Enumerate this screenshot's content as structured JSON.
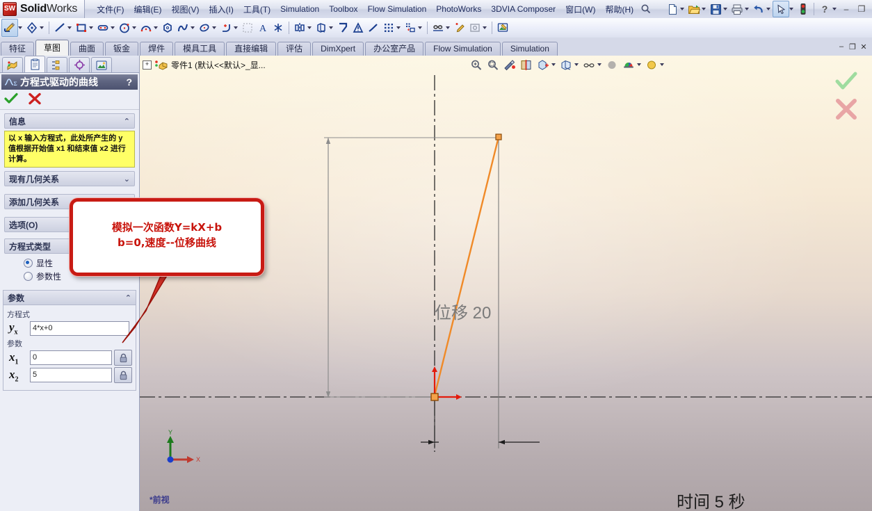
{
  "app": {
    "brand_bold": "Solid",
    "brand_light": "Works",
    "logo_mark": "SW"
  },
  "menu": {
    "items": [
      {
        "label": "文件(F)",
        "name": "menu-file"
      },
      {
        "label": "编辑(E)",
        "name": "menu-edit"
      },
      {
        "label": "视图(V)",
        "name": "menu-view"
      },
      {
        "label": "插入(I)",
        "name": "menu-insert"
      },
      {
        "label": "工具(T)",
        "name": "menu-tools"
      },
      {
        "label": "Simulation",
        "name": "menu-simulation"
      },
      {
        "label": "Toolbox",
        "name": "menu-toolbox"
      },
      {
        "label": "Flow Simulation",
        "name": "menu-flow-simulation"
      },
      {
        "label": "PhotoWorks",
        "name": "menu-photoworks"
      },
      {
        "label": "3DVIA Composer",
        "name": "menu-3dvia-composer"
      },
      {
        "label": "窗口(W)",
        "name": "menu-window"
      },
      {
        "label": "帮助(H)",
        "name": "menu-help"
      }
    ],
    "quick_access": [
      "new-document-icon",
      "open-folder-icon",
      "save-icon",
      "print-icon",
      "undo-icon",
      "select-arrow-icon",
      "rebuild-icon"
    ],
    "help_label": "?",
    "minimize_label": "–",
    "restore_label": "❐"
  },
  "sketch_toolbar": {
    "icons": [
      "sketch-pencil-icon",
      "smart-dimension-icon",
      "line-icon",
      "rectangle-icon",
      "slot-icon",
      "circle-icon",
      "arc-icon",
      "polygon-icon",
      "spline-icon",
      "ellipse-icon",
      "fillet-icon",
      "trim-icon",
      "offset-entities-icon",
      "text-icon",
      "point-icon",
      "mirror-icon",
      "convert-entities-icon",
      "extend-icon",
      "construction-geometry-icon",
      "curve-icon",
      "linear-pattern-icon",
      "move-entities-icon",
      "display-delete-relation-icon",
      "quick-snap-icon",
      "repair-sketch-icon",
      "sketch-picture-icon"
    ]
  },
  "command_tabs": {
    "tabs": [
      {
        "label": "特征",
        "active": false
      },
      {
        "label": "草图",
        "active": true
      },
      {
        "label": "曲面",
        "active": false
      },
      {
        "label": "钣金",
        "active": false
      },
      {
        "label": "焊件",
        "active": false
      },
      {
        "label": "模具工具",
        "active": false
      },
      {
        "label": "直接编辑",
        "active": false
      },
      {
        "label": "评估",
        "active": false
      },
      {
        "label": "DimXpert",
        "active": false
      },
      {
        "label": "办公室产品",
        "active": false
      },
      {
        "label": "Flow Simulation",
        "active": false
      },
      {
        "label": "Simulation",
        "active": false
      }
    ],
    "window_buttons": [
      "–",
      "❐",
      "✕"
    ]
  },
  "property_manager": {
    "tabs": [
      {
        "name": "feature-manager-tab",
        "icon": "feature-tree-icon",
        "active": false
      },
      {
        "name": "property-manager-tab",
        "icon": "property-clipboard-icon",
        "active": true
      },
      {
        "name": "configuration-manager-tab",
        "icon": "configuration-icon",
        "active": false
      },
      {
        "name": "dimxpert-manager-tab",
        "icon": "dimxpert-target-icon",
        "active": false
      },
      {
        "name": "display-manager-tab",
        "icon": "display-image-icon",
        "active": false
      }
    ],
    "title": "方程式驱动的曲线",
    "title_icon": "equation-curve-icon",
    "help_badge": "?",
    "ok_icon": "green-check-icon",
    "cancel_icon": "red-x-icon",
    "sections": {
      "info": {
        "header": "信息",
        "chevron": "⌃",
        "body": "以 x 输入方程式，此处所产生的 y 值根据开始值 x1 和结束值 x2 进行计算。"
      },
      "existing_relations": {
        "header": "现有几何关系",
        "chevron": "⌄"
      },
      "add_relations": {
        "header": "添加几何关系",
        "chevron": "⌄"
      },
      "options": {
        "header": "选项(O)",
        "chevron": "⌄"
      },
      "equation_type": {
        "header": "方程式类型",
        "options": [
          {
            "label": "显性",
            "selected": true
          },
          {
            "label": "参数性",
            "selected": false
          }
        ]
      },
      "parameters": {
        "header": "参数",
        "chevron": "⌃",
        "equation_label": "方程式",
        "equation_symbol": "y",
        "equation_symbol_sub": "x",
        "equation_value": "4*x+0",
        "parameters_label": "参数",
        "rows": [
          {
            "symbol": "x",
            "sub": "1",
            "value": "0",
            "lock_icon": "lock-icon"
          },
          {
            "symbol": "x",
            "sub": "2",
            "value": "5",
            "lock_icon": "lock-icon"
          }
        ]
      }
    }
  },
  "graphics": {
    "tree_expander": "+",
    "tree_icon": "part-icon",
    "tree_label": "零件1   (默认<<默认>_显...",
    "view_toolbar": [
      "zoom-to-fit-icon",
      "zoom-to-area-icon",
      "previous-view-icon",
      "section-view-icon",
      "view-orientation-icon",
      "display-style-icon",
      "hide-show-items-icon",
      "edit-appearance-icon",
      "apply-scene-icon",
      "view-settings-icon"
    ],
    "confirm_ok_icon": "green-check-icon",
    "confirm_cancel_icon": "red-x-icon",
    "view_label": "*前视",
    "triad": {
      "x_label": "X",
      "y_label": "Y"
    },
    "annotations": [
      {
        "name": "displacement-dimension",
        "text": "位移 20"
      },
      {
        "name": "time-dimension",
        "text": "时间 5 秒"
      }
    ]
  },
  "callout": {
    "lines": [
      "模拟一次函数Y=kX+b",
      "b=0,速度--位移曲线"
    ],
    "border_color": "#c81b14",
    "text_color": "#c8140c"
  },
  "colors": {
    "sketch_curve": "#f08a28",
    "origin_red": "#e31b0c",
    "centerline": "#2b2b2b",
    "dimension_gray": "#6e6e6e",
    "info_yellow": "#ffff66",
    "panel_bg": "#eceef6",
    "title_bar": "#5e6480"
  }
}
